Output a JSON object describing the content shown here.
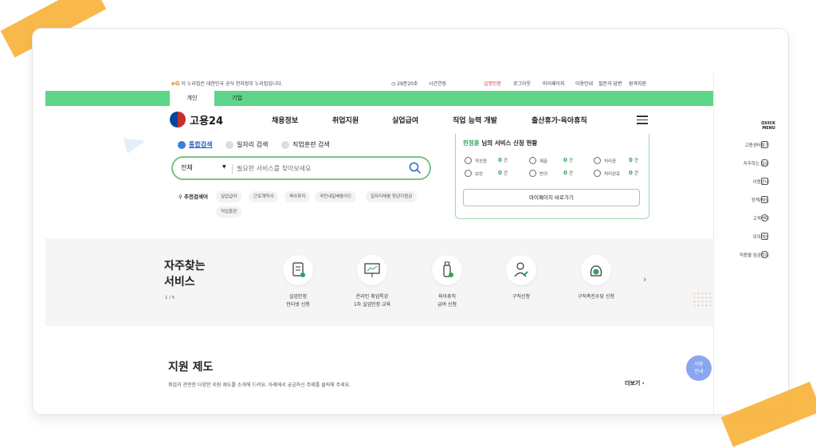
{
  "topbar": {
    "gov_notice": "이 누리집은 대한민국 공식 전자정부 누리집입니다.",
    "timer": "29분20초",
    "extend": "시간연장",
    "user_auth": "실명인증",
    "logout": "로그아웃",
    "mypage": "마이페이지",
    "guide": "이용안내",
    "faq": "질문과 답변",
    "remote": "원격지원"
  },
  "tabs": {
    "personal": "개인",
    "business": "기업"
  },
  "header": {
    "logo": "고용24",
    "nav": [
      "채용정보",
      "취업지원",
      "실업급여",
      "직업 능력 개발",
      "출산휴가·육아휴직"
    ]
  },
  "search": {
    "options": [
      "통합검색",
      "일자리 검색",
      "직업훈련 검색"
    ],
    "scope": "전체",
    "placeholder": "필요한 서비스를 찾아보세요",
    "recommend_title": "추천검색어",
    "keywords": [
      "실업급여",
      "근로계약서",
      "육아휴직",
      "국민내일배움카드",
      "일자리채움 청년지원금",
      "직업훈련"
    ]
  },
  "status": {
    "user": "한정훈",
    "title_suffix": " 님의 서비스 신청 현황",
    "items": [
      {
        "label": "작성중",
        "count": "0",
        "unit": "건"
      },
      {
        "label": "제출",
        "count": "0",
        "unit": "건"
      },
      {
        "label": "처리중",
        "count": "0",
        "unit": "건"
      },
      {
        "label": "보완",
        "count": "0",
        "unit": "건"
      },
      {
        "label": "반려",
        "count": "0",
        "unit": "건"
      },
      {
        "label": "처리완료",
        "count": "0",
        "unit": "건"
      }
    ],
    "mypage_button": "마이페이지 바로가기"
  },
  "faq_services": {
    "title": "자주찾는\n서비스",
    "pager": "1 / 5",
    "items": [
      {
        "label": "실업인정\n인터넷 신청",
        "icon": "document-check-icon"
      },
      {
        "label": "온라인 취업특강\n1차 실업인정 교육",
        "icon": "presentation-icon"
      },
      {
        "label": "육아휴직\n급여 신청",
        "icon": "baby-bottle-icon"
      },
      {
        "label": "구직신청",
        "icon": "person-edit-icon"
      },
      {
        "label": "구직촉진수당 신청",
        "icon": "money-bag-icon"
      }
    ]
  },
  "support": {
    "title": "지원 제도",
    "desc": "취업과 관련한 다양한 지원 제도를 소개해 드려요. 아래에서 궁금하신 주제를 클릭해 주세요.",
    "more": "더보기"
  },
  "guide_float": "이용\n안내",
  "quick_menu": {
    "title": "QUICK\nMENU",
    "items": [
      "고용센터찾기",
      "자주하는 질문",
      "이용안내",
      "정책/제도",
      "고객센터",
      "모의계산",
      "직종별 임금정보"
    ]
  },
  "colors": {
    "brand_green": "#5ed588",
    "accent_green": "#26a65b",
    "tape": "#f7b23b",
    "guide_blue": "#8aa6f0"
  }
}
